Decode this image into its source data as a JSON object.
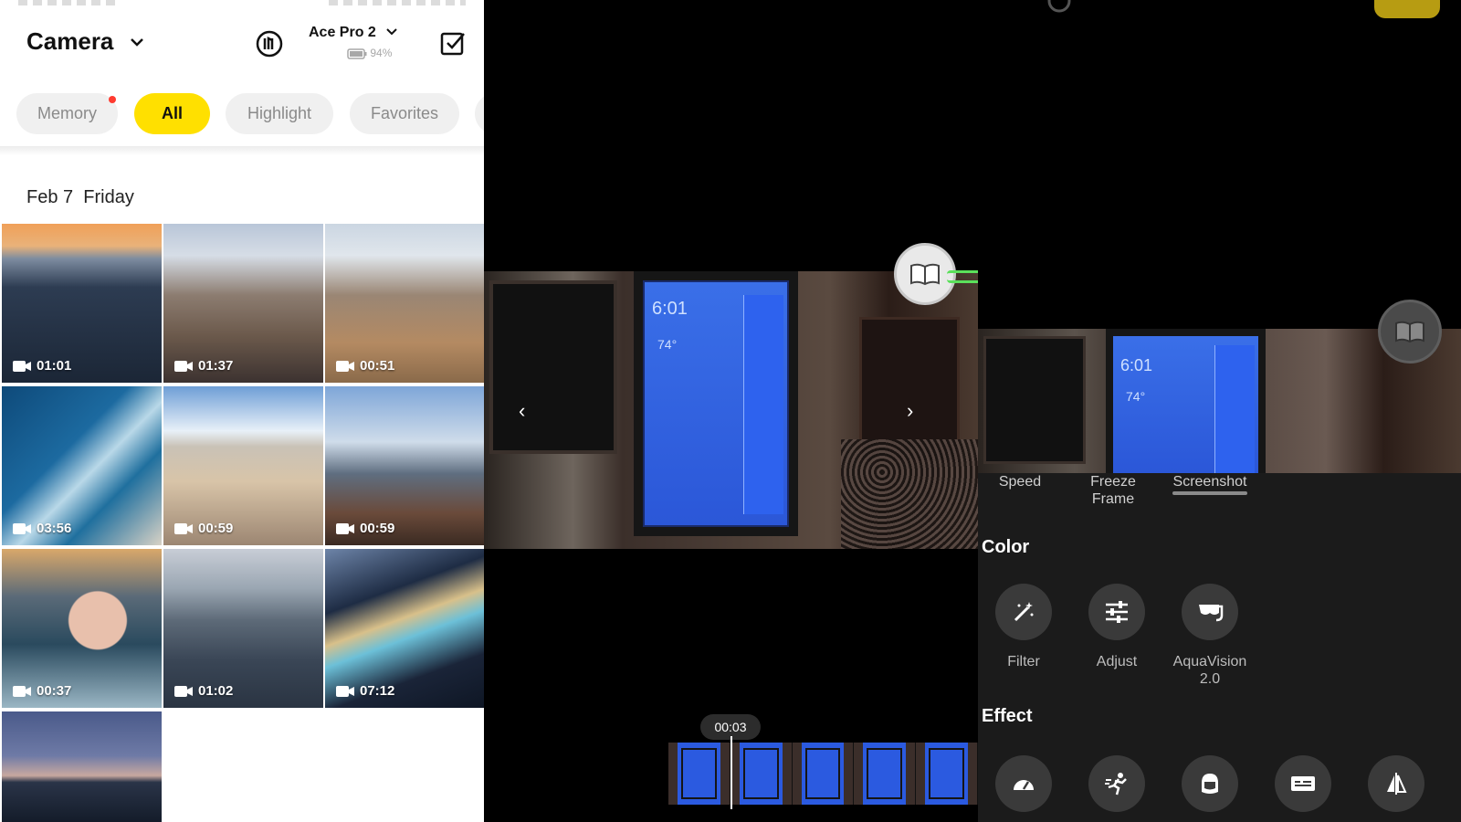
{
  "gallery": {
    "title": "Camera",
    "device_name": "Ace Pro 2",
    "battery_text": "94%",
    "tabs": [
      {
        "label": "Memory",
        "dot": true
      },
      {
        "label": "All",
        "active": true
      },
      {
        "label": "Highlight"
      },
      {
        "label": "Favorites"
      }
    ],
    "date_label": "Feb 7  Friday",
    "items": [
      {
        "duration": "01:01"
      },
      {
        "duration": "01:37"
      },
      {
        "duration": "00:51"
      },
      {
        "duration": "03:56"
      },
      {
        "duration": "00:59"
      },
      {
        "duration": "00:59"
      },
      {
        "duration": "00:37"
      },
      {
        "duration": "01:02"
      },
      {
        "duration": "07:12"
      },
      {
        "duration": ""
      }
    ]
  },
  "player": {
    "screen_time": "6:01",
    "screen_temp": "74°",
    "timestamp": "00:03"
  },
  "editor": {
    "tool_tabs": [
      "Speed",
      "Freeze\nFrame",
      "Screenshot"
    ],
    "color_section": "Color",
    "color_tools": [
      "Filter",
      "Adjust",
      "AquaVision\n2.0"
    ],
    "effect_section": "Effect"
  },
  "colors": {
    "accent": "#ffe000",
    "dot": "#ff3b30",
    "panel_bg": "#1b1b1b"
  }
}
